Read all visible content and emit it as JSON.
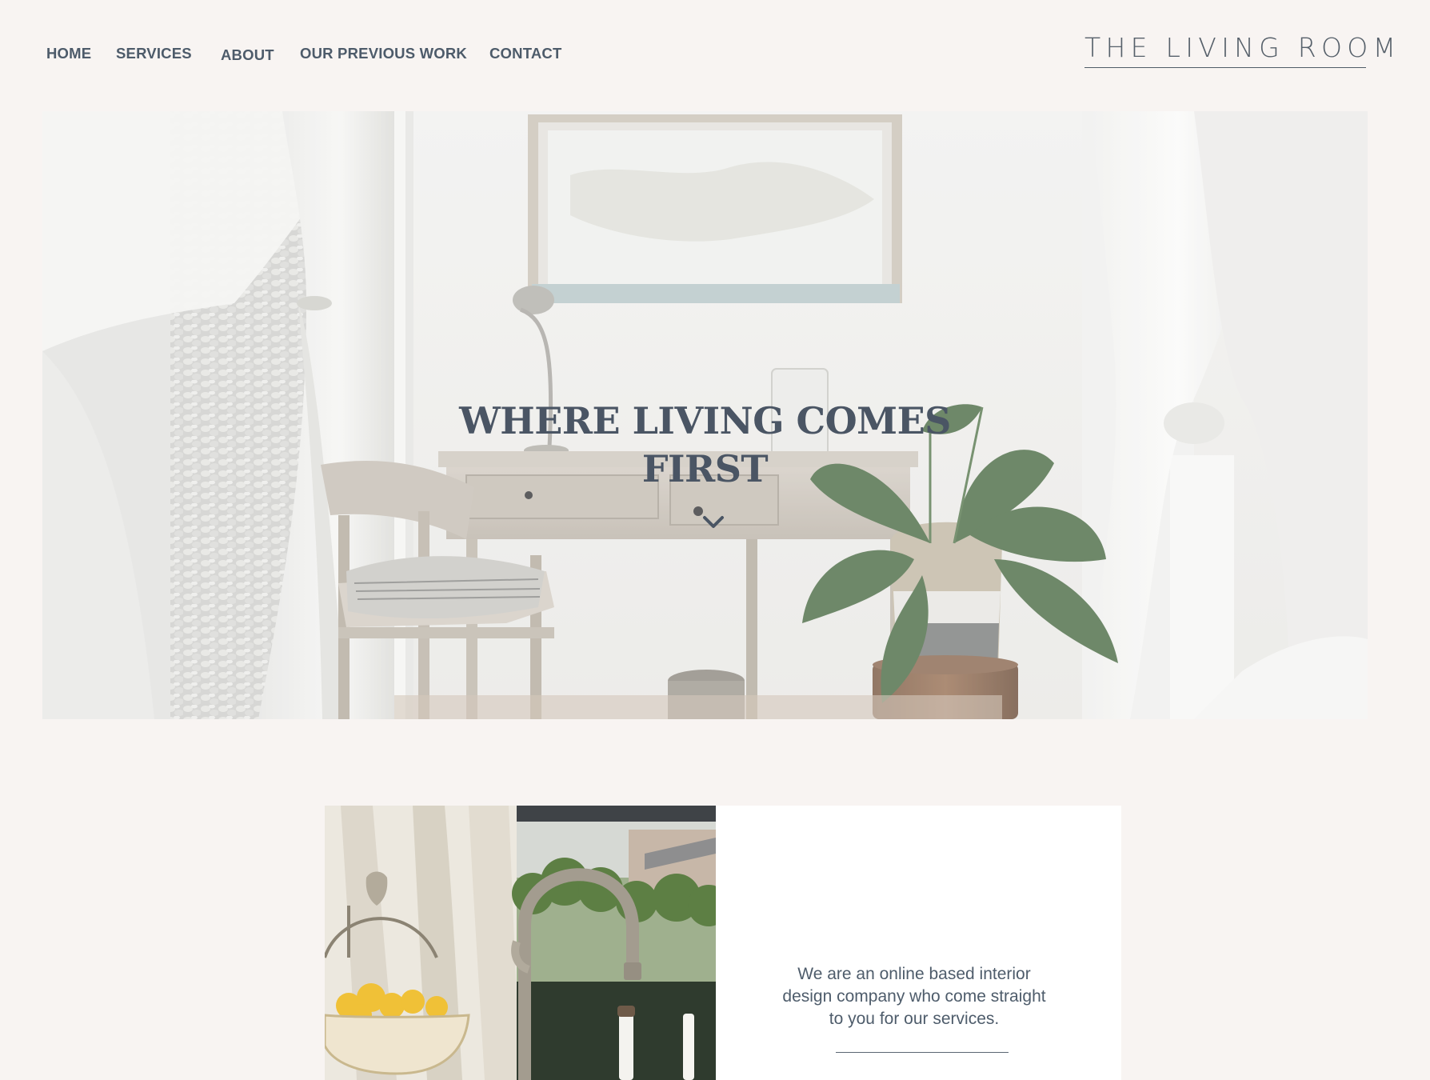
{
  "nav": {
    "items": [
      {
        "label": "HOME"
      },
      {
        "label": "SERVICES"
      },
      {
        "label": "ABOUT"
      },
      {
        "label": "OUR PREVIOUS WORK"
      },
      {
        "label": "CONTACT"
      }
    ]
  },
  "logo": {
    "text": "THE LIVING ROOM"
  },
  "hero": {
    "title_line1": "WHERE LIVING COMES",
    "title_line2": "FIRST",
    "scroll_icon": "chevron-down-icon"
  },
  "about": {
    "text": "We are an online based interior design company who come straight to you for our services."
  },
  "colors": {
    "page_background": "#f8f4f2",
    "text_primary": "#4d5b6a",
    "card_background": "#ffffff"
  }
}
